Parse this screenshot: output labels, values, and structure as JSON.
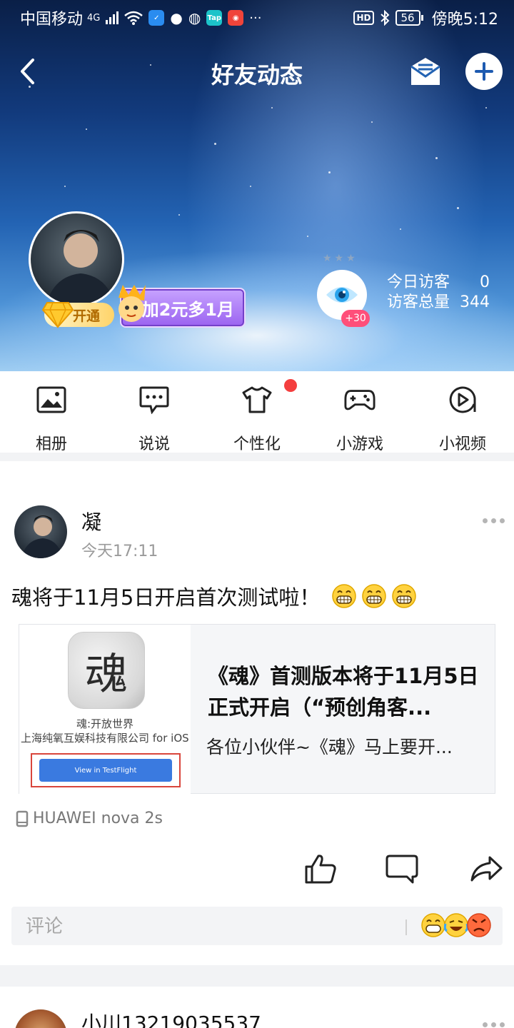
{
  "status_bar": {
    "carrier": "中国移动",
    "network": "4G",
    "hd": "HD",
    "battery": "56",
    "time": "傍晚5:12",
    "mini_app_tap": "Tap"
  },
  "header": {
    "title": "好友动态"
  },
  "profile": {
    "vip_label": "开通",
    "promo_text": "加2元多1月",
    "visitor_badge": "+30",
    "today_visitors_label": "今日访客",
    "today_visitors": "0",
    "total_visitors_label": "访客总量",
    "total_visitors": "344"
  },
  "quick_nav": [
    {
      "label": "相册",
      "icon": "photo-album-icon"
    },
    {
      "label": "说说",
      "icon": "speech-bubble-icon"
    },
    {
      "label": "个性化",
      "icon": "tshirt-icon"
    },
    {
      "label": "小游戏",
      "icon": "gamepad-icon"
    },
    {
      "label": "小视频",
      "icon": "video-play-icon"
    }
  ],
  "post": {
    "author": "凝",
    "time": "今天17:11",
    "text": "魂将于11月5日开启首次测试啦！",
    "link_card": {
      "app_icon_char": "魂",
      "app_name": "魂:开放世界",
      "app_company": "上海纯氧互娱科技有限公司 for iOS",
      "testflight_button": "View in TestFlight",
      "title": "《魂》首测版本将于11月5日正式开启（“预创角客...",
      "description": "各位小伙伴~《魂》马上要开..."
    },
    "device": "HUAWEI nova 2s",
    "comment_placeholder": "评论"
  },
  "next_post": {
    "author": "小川13219035537"
  },
  "colors": {
    "accent_blue": "#3a7ae0",
    "notification_red": "#f43e3e",
    "visitor_badge_pink": "#ff4f7a",
    "promo_purple": "#9b63f0"
  }
}
